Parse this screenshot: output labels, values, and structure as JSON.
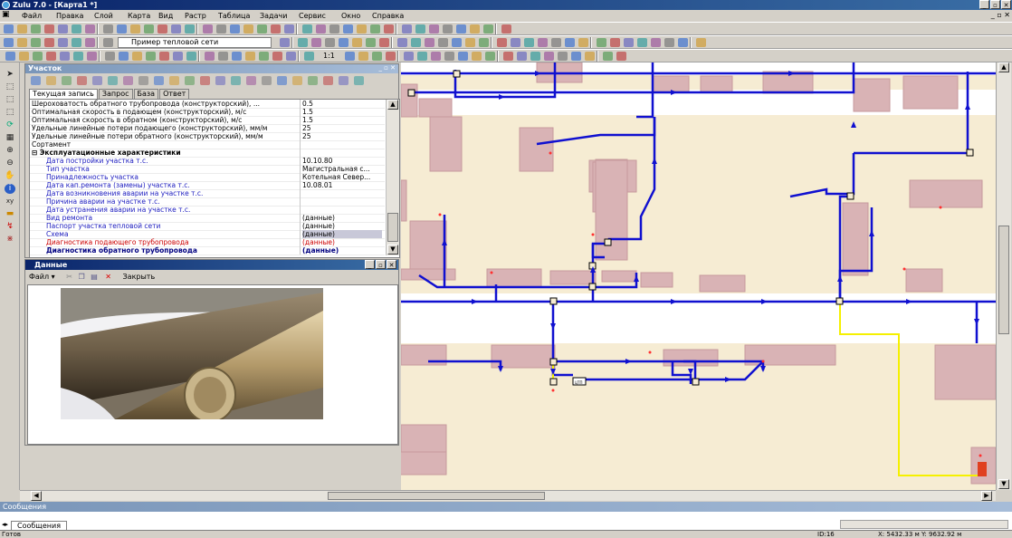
{
  "app": {
    "title": "Zulu 7.0 - [Карта1 *]"
  },
  "menu": [
    "Файл",
    "Правка",
    "Слой",
    "Карта",
    "Вид",
    "Растр",
    "Таблица",
    "Задачи",
    "Сервис",
    "Окно",
    "Справка"
  ],
  "toolbar": {
    "layer_combo": "Пример тепловой сети",
    "scale_label": "1:1"
  },
  "panel": {
    "title": "Участок",
    "tabs": [
      "Текущая запись",
      "Запрос",
      "База",
      "Ответ"
    ],
    "rows": [
      {
        "k": "Шероховатость обратного трубопровода (конструкторский), ...",
        "v": "0.5",
        "cls": ""
      },
      {
        "k": "Оптимальная скорость в подающем (конструкторский), м/с",
        "v": "1.5",
        "cls": ""
      },
      {
        "k": "Оптимальная скорость в обратном (конструкторский), м/с",
        "v": "1.5",
        "cls": ""
      },
      {
        "k": "Удельные линейные потери подающего (конструкторский), мм/м",
        "v": "25",
        "cls": ""
      },
      {
        "k": "Удельные линейные потери обратного (конструкторский), мм/м",
        "v": "25",
        "cls": ""
      },
      {
        "k": "Сортамент",
        "v": "",
        "cls": ""
      },
      {
        "k": "⊟ Эксплуатационные характеристики",
        "v": "",
        "cls": "hdr"
      },
      {
        "k": "Дата постройки участка т.с.",
        "v": "10.10.80",
        "cls": "sub"
      },
      {
        "k": "Тип участка",
        "v": "Магистральная с...",
        "cls": "sub"
      },
      {
        "k": "Принадлежность участка",
        "v": "Котельная Север...",
        "cls": "sub"
      },
      {
        "k": "Дата кап.ремонта (замены) участка т.с.",
        "v": "10.08.01",
        "cls": "sub"
      },
      {
        "k": "Дата возникновения аварии на участке т.с.",
        "v": "",
        "cls": "sub"
      },
      {
        "k": "Причина аварии на участке т.с.",
        "v": "",
        "cls": "sub"
      },
      {
        "k": "Дата устранения аварии на участке т.с.",
        "v": "",
        "cls": "sub"
      },
      {
        "k": "Вид ремонта",
        "v": "(данные)",
        "cls": "sub"
      },
      {
        "k": "Паспорт участка тепловой сети",
        "v": "(данные)",
        "cls": "sub"
      },
      {
        "k": "Схема",
        "v": "(данные)",
        "cls": "sub sel"
      },
      {
        "k": "Диагностика подающего трубопровода",
        "v": "(данные)",
        "cls": "sub red"
      },
      {
        "k": "Диагностика обратного трубопровода",
        "v": "(данные)",
        "cls": "sub bold"
      }
    ]
  },
  "data_window": {
    "title": "Данные",
    "file_menu": "Файл",
    "close_label": "Закрыть"
  },
  "map": {
    "node_label": "ЦТП"
  },
  "messages": {
    "title": "Сообщения",
    "tab": "Сообщения"
  },
  "status": {
    "ready": "Готов",
    "id": "ID:16",
    "coords": "X: 5432.33 м  Y: 9632.92 м"
  }
}
